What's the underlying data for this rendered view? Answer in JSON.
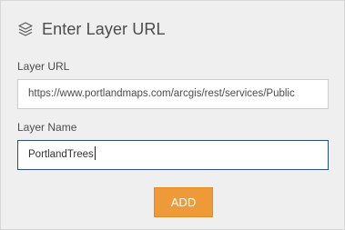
{
  "header": {
    "icon": "layers-icon",
    "title": "Enter Layer URL"
  },
  "form": {
    "url_label": "Layer URL",
    "url_value": "https://www.portlandmaps.com/arcgis/rest/services/Public",
    "name_label": "Layer Name",
    "name_value": "PortlandTrees"
  },
  "actions": {
    "add_label": "ADD"
  },
  "colors": {
    "panel_background": "#efefef",
    "accent_button": "#ef9a38",
    "focused_border": "#2a4f7a"
  }
}
